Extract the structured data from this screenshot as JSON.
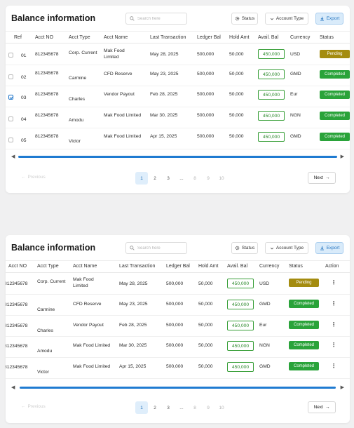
{
  "header": {
    "title": "Balance information",
    "search_placeholder": "Search here",
    "status_label": "Status",
    "account_type_label": "Account Type",
    "export_label": "Export"
  },
  "columns": {
    "ref": "Ref",
    "acct_no": "Acct NO",
    "acct_type": "Acct Type",
    "acct_name": "Acct Name",
    "last_txn": "Last Transaction",
    "ledger": "Ledger Bal",
    "hold": "Hold Amt",
    "avail": "Avail. Bal",
    "currency": "Currency",
    "status": "Status",
    "action": "Action"
  },
  "rows": [
    {
      "ref": "01",
      "checked": false,
      "acct_no": "812345678",
      "acct_type": "Corp. Current",
      "acct_name": "Mak Food Limited",
      "last_txn": "May 28, 2025",
      "ledger": "500,000",
      "hold": "50,000",
      "avail": "450,000",
      "currency": "USD",
      "status": "Pending"
    },
    {
      "ref": "02",
      "checked": false,
      "acct_no": "812345678",
      "acct_type": "Carmine",
      "acct_name": "CFD Reserve",
      "last_txn": "May 23, 2025",
      "ledger": "500,000",
      "hold": "50,000",
      "avail": "450,000",
      "currency": "GMD",
      "status": "Completed"
    },
    {
      "ref": "03",
      "checked": true,
      "acct_no": "812345678",
      "acct_type": "Charles",
      "acct_name": "Vendor Payout",
      "last_txn": "Feb 28, 2025",
      "ledger": "500,000",
      "hold": "50,000",
      "avail": "450,000",
      "currency": "Eur",
      "status": "Completed"
    },
    {
      "ref": "04",
      "checked": false,
      "acct_no": "812345678",
      "acct_type": "Amodu",
      "acct_name": "Mak Food Limited",
      "last_txn": "Mar 30, 2025",
      "ledger": "500,000",
      "hold": "50,000",
      "avail": "450,000",
      "currency": "NGN",
      "status": "Completed"
    },
    {
      "ref": "05",
      "checked": false,
      "acct_no": "812345678",
      "acct_type": "Victor",
      "acct_name": "Mak Food Limited",
      "last_txn": "Apr 15, 2025",
      "ledger": "500,000",
      "hold": "50,000",
      "avail": "450,000",
      "currency": "GMD",
      "status": "Completed"
    }
  ],
  "pagination": {
    "previous_label": "Previous",
    "pages": [
      "1",
      "2",
      "3",
      "...",
      "8",
      "9",
      "10"
    ],
    "active_page": "1",
    "next_label": "Next"
  },
  "colors": {
    "accent": "#1f7bd1",
    "pending": "#a48c10",
    "completed": "#2aa33a",
    "avail_border": "#3aa03a"
  }
}
